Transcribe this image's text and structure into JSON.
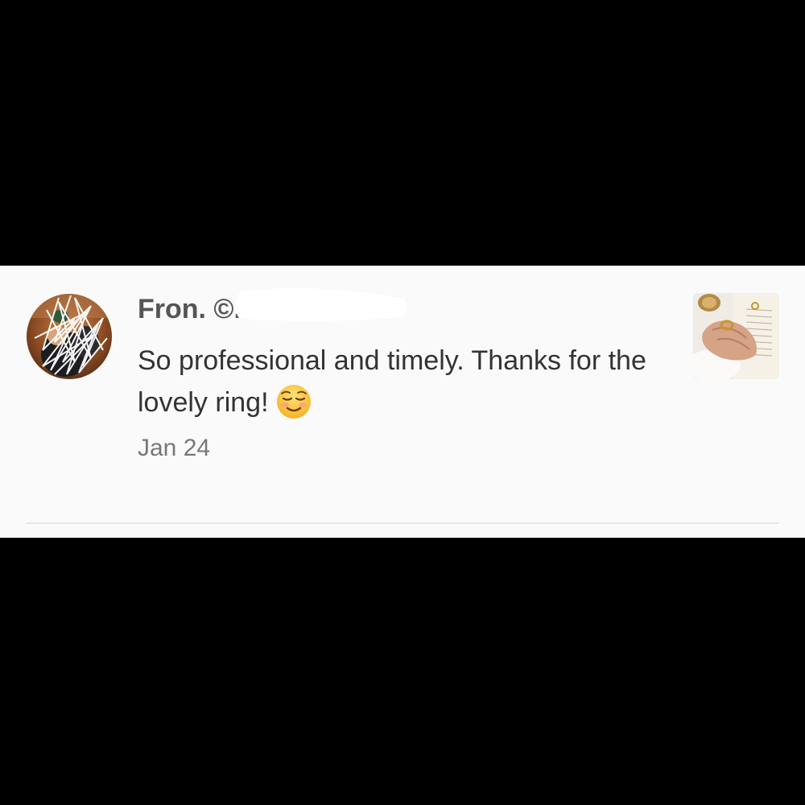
{
  "review": {
    "from_label": "Fron. ©.",
    "comment": "So professional and timely. Thanks for the lovely ring!",
    "emoji": "☺️",
    "date": "Jan 24"
  },
  "icons": {
    "avatar": "reviewer-avatar-scribbled",
    "emoji": "smiling-face-icon",
    "thumbnail": "ring-photo-thumbnail"
  },
  "colors": {
    "background": "#000000",
    "card": "#fafafa",
    "name_text": "#555555",
    "body_text": "#333333",
    "date_text": "#777777",
    "divider": "#e7e7e7"
  }
}
